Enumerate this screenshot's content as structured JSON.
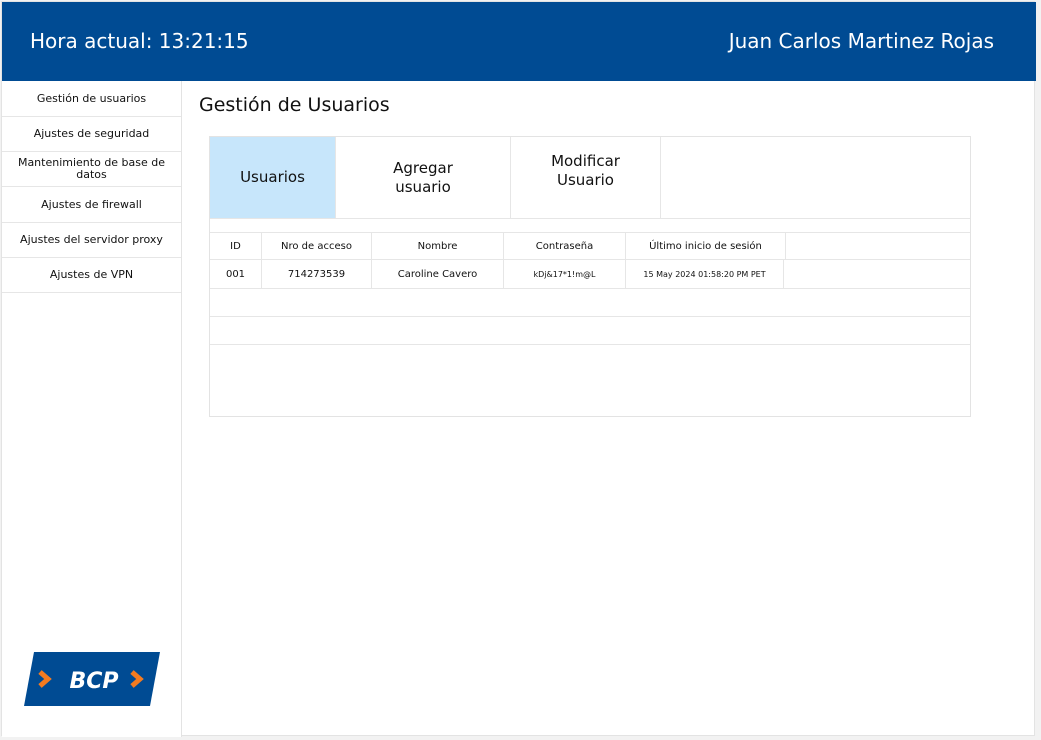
{
  "header": {
    "clock_label": "Hora actual: 13:21:15",
    "user_name": "Juan Carlos Martinez Rojas"
  },
  "sidebar": {
    "items": [
      {
        "label": "Gestión de usuarios"
      },
      {
        "label": "Ajustes de seguridad"
      },
      {
        "label": "Mantenimiento de base de datos"
      },
      {
        "label": "Ajustes de firewall"
      },
      {
        "label": "Ajustes del servidor proxy"
      },
      {
        "label": "Ajustes de VPN"
      }
    ],
    "logo_text": "BCP"
  },
  "main": {
    "title": "Gestión de Usuarios",
    "tabs": [
      {
        "label": "Usuarios",
        "active": true
      },
      {
        "label": "Agregar usuario",
        "active": false
      },
      {
        "label": "Modificar Usuario",
        "active": false
      }
    ],
    "table": {
      "columns": [
        "ID",
        "Nro de acceso",
        "Nombre",
        "Contraseña",
        "Último inicio de sesión"
      ],
      "rows": [
        [
          "001",
          "714273539",
          "Caroline Cavero",
          "kDj&17*1!m@L",
          "15 May 2024 01:58:20 PM PET"
        ]
      ]
    }
  },
  "colors": {
    "header_bg": "#004b93",
    "active_tab": "#c7e6fb",
    "logo_orange": "#f47b20"
  }
}
